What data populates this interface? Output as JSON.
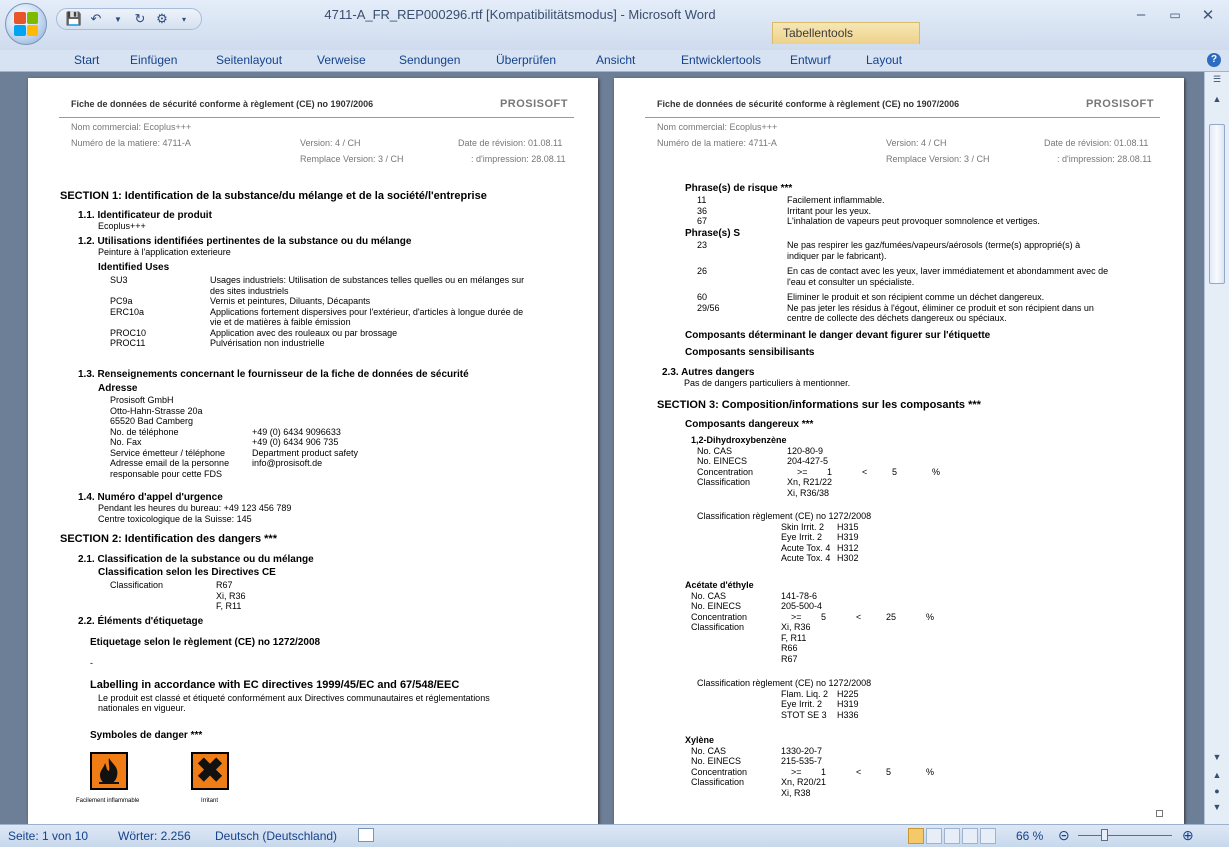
{
  "window": {
    "title": "4711-A_FR_REP000296.rtf [Kompatibilitätsmodus] - Microsoft Word",
    "context_tab": "Tabellentools"
  },
  "ribbon_tabs": [
    "Start",
    "Einfügen",
    "Seitenlayout",
    "Verweise",
    "Sendungen",
    "Überprüfen",
    "Ansicht",
    "Entwicklertools",
    "Entwurf",
    "Layout"
  ],
  "status": {
    "page": "Seite: 1 von 10",
    "words": "Wörter: 2.256",
    "language": "Deutsch (Deutschland)",
    "zoom": "66 %"
  },
  "header": {
    "title": "Fiche de données de sécurité conforme à règlement (CE) no 1907/2006",
    "logo": "PROSISOFT",
    "trade_name": "Nom commercial: Ecoplus+++",
    "material_no": "Numéro de la matiere: 4711-A",
    "version": "Version: 4 / CH",
    "replaces": "Remplace Version: 3 / CH",
    "revision_date": "Date de révision: 01.08.11",
    "print_date": ": d'impression: 28.08.11"
  },
  "page1": {
    "s1": "SECTION 1: Identification de la substance/du mélange et de la société/l'entreprise",
    "s11": "1.1. Identificateur de produit",
    "s11v": "Ecoplus+++",
    "s12": "1.2. Utilisations identifiées pertinentes de la substance ou du mélange",
    "s12v": "Peinture à l'application exterieure",
    "identified_uses": "Identified Uses",
    "uses": [
      {
        "code": "SU3",
        "text": "Usages industriels: Utilisation de substances telles quelles ou en mélanges sur"
      },
      {
        "code": "",
        "text": "des sites industriels"
      },
      {
        "code": "PC9a",
        "text": "Vernis et peintures, Diluants, Décapants"
      },
      {
        "code": "ERC10a",
        "text": "Applications fortement dispersives pour l'extérieur, d'articles à longue durée de"
      },
      {
        "code": "",
        "text": "vie et de matières à faible émission"
      },
      {
        "code": "PROC10",
        "text": "Application avec des rouleaux ou par brossage"
      },
      {
        "code": "PROC11",
        "text": "Pulvérisation non industrielle"
      }
    ],
    "s13": "1.3. Renseignements concernant le fournisseur de la fiche de données de sécurité",
    "adresse": "Adresse",
    "address_lines": [
      "Prosisoft GmbH",
      "Otto-Hahn-Strasse 20a",
      "65520 Bad Camberg"
    ],
    "contacts": [
      {
        "k": "No. de téléphone",
        "v": "+49 (0) 6434 9096633"
      },
      {
        "k": "No. Fax",
        "v": "+49 (0) 6434 906 735"
      },
      {
        "k": "Service émetteur / téléphone",
        "v": "Department product safety"
      },
      {
        "k": "Adresse email de la personne",
        "v": "info@prosisoft.de"
      },
      {
        "k": "responsable pour cette FDS",
        "v": ""
      }
    ],
    "s14": "1.4. Numéro d'appel d'urgence",
    "s14a": "Pendant les heures du bureau: +49 123 456 789",
    "s14b": "Centre toxicologique de la Suisse: 145",
    "s2": "SECTION 2: Identification des dangers ***",
    "s21": "2.1. Classification de la substance ou du mélange",
    "s21b": "Classification selon les Directives CE",
    "class_label": "Classification",
    "class_values": [
      "R67",
      "Xi, R36",
      "F, R11"
    ],
    "s22": "2.2. Éléments d'étiquetage",
    "etiq": "Etiquetage selon le règlement (CE) no 1272/2008",
    "dash": "-",
    "labelling": "Labelling in accordance with EC directives 1999/45/EC and 67/548/EEC",
    "labelling_text1": "Le produit est classé et étiqueté conformément aux Directives communautaires et réglementations",
    "labelling_text2": "nationales en vigueur.",
    "symbols": "Symboles de danger ***",
    "sym1": "Facilement inflammable",
    "sym2": "Irritant"
  },
  "page2": {
    "risk": "Phrase(s) de risque ***",
    "risk_items": [
      {
        "n": "11",
        "t": "Facilement inflammable."
      },
      {
        "n": "36",
        "t": "Irritant pour les yeux."
      },
      {
        "n": "67",
        "t": "L'inhalation de vapeurs peut provoquer somnolence et vertiges."
      }
    ],
    "sphr": "Phrase(s) S",
    "s_items": [
      {
        "n": "23",
        "t": "Ne pas respirer les gaz/fumées/vapeurs/aérosols (terme(s) approprié(s) à"
      },
      {
        "n": "",
        "t": "indiquer par le fabricant)."
      },
      {
        "n": "26",
        "t": "En cas de contact avec les yeux, laver immédiatement et abondamment avec de"
      },
      {
        "n": "",
        "t": "l'eau et consulter un spécialiste."
      },
      {
        "n": "60",
        "t": "Eliminer le produit et son récipient comme un déchet dangereux."
      },
      {
        "n": "29/56",
        "t": "Ne pas jeter les résidus à l'égout, éliminer ce produit et son récipient dans un"
      },
      {
        "n": "",
        "t": "centre de collecte des déchets dangereux ou spéciaux."
      }
    ],
    "comp_det": "Composants déterminant le danger devant figurer sur l'étiquette",
    "comp_sens": "Composants sensibilisants",
    "s23": "2.3. Autres dangers",
    "s23v": "Pas de dangers particuliers à mentionner.",
    "s3": "SECTION 3: Composition/informations sur les composants ***",
    "comp_dang": "Composants dangereux ***",
    "subs": [
      {
        "name": "1,2-Dihydroxybenzène",
        "cas": "120-80-9",
        "einecs": "204-427-5",
        "conc": [
          ">=",
          "1",
          "<",
          "5",
          "%"
        ],
        "cls": [
          "Xn, R21/22",
          "Xi, R36/38"
        ],
        "reg": [
          [
            "Skin Irrit. 2",
            "H315"
          ],
          [
            "Eye Irrit. 2",
            "H319"
          ],
          [
            "Acute Tox. 4",
            "H312"
          ],
          [
            "Acute Tox. 4",
            "H302"
          ]
        ]
      },
      {
        "name": "Acétate d'éthyle",
        "cas": "141-78-6",
        "einecs": "205-500-4",
        "conc": [
          ">=",
          "5",
          "<",
          "25",
          "%"
        ],
        "cls": [
          "Xi, R36",
          "F, R11",
          "R66",
          "R67"
        ],
        "reg": [
          [
            "Flam. Liq. 2",
            "H225"
          ],
          [
            "Eye Irrit. 2",
            "H319"
          ],
          [
            "STOT SE 3",
            "H336"
          ]
        ]
      },
      {
        "name": "Xylène",
        "cas": "1330-20-7",
        "einecs": "215-535-7",
        "conc": [
          ">=",
          "1",
          "<",
          "5",
          "%"
        ],
        "cls": [
          "Xn, R20/21",
          "Xi, R38"
        ],
        "reg": []
      }
    ],
    "lbl_cas": "No. CAS",
    "lbl_einecs": "No. EINECS",
    "lbl_conc": "Concentration",
    "lbl_class": "Classification",
    "lbl_reg": "Classification règlement (CE) no 1272/2008"
  }
}
